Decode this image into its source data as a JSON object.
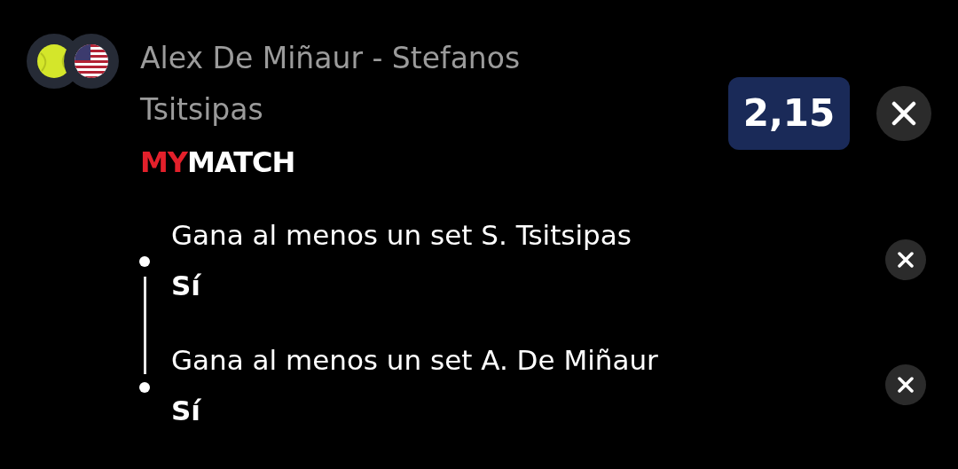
{
  "event": {
    "title": "Alex De Miñaur - Stefanos Tsitsipas",
    "brand": [
      {
        "text": "MY",
        "color": "#e3202b"
      },
      {
        "text": "MATCH",
        "color": "#ffffff"
      }
    ],
    "odds": "2,15"
  },
  "selections": [
    {
      "market": "Gana al menos un set S. Tsitsipas",
      "pick": "Sí"
    },
    {
      "market": "Gana al menos un set A. De Miñaur",
      "pick": "Sí"
    }
  ]
}
